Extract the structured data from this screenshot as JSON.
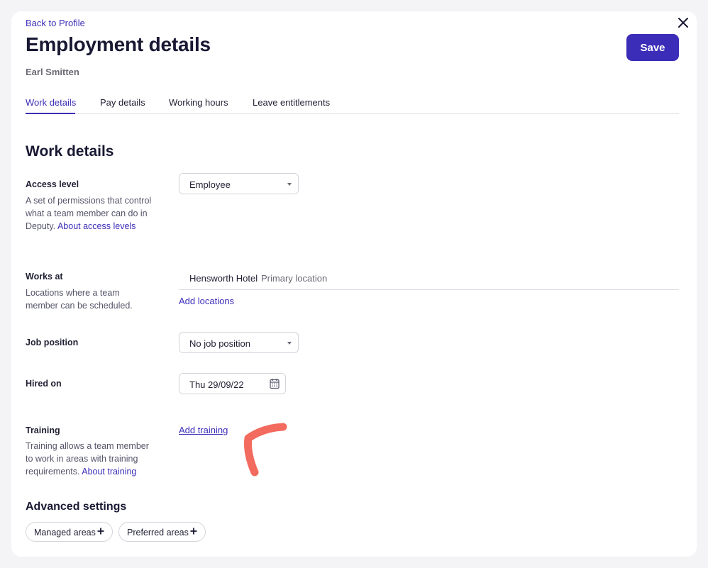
{
  "header": {
    "back_link": "Back to Profile",
    "title": "Employment details",
    "employee_name": "Earl Smitten",
    "save_label": "Save",
    "close_icon": "close-icon"
  },
  "tabs": [
    {
      "label": "Work details",
      "active": true
    },
    {
      "label": "Pay details",
      "active": false
    },
    {
      "label": "Working hours",
      "active": false
    },
    {
      "label": "Leave entitlements",
      "active": false
    }
  ],
  "section_title": "Work details",
  "fields": {
    "access_level": {
      "label": "Access level",
      "help": "A set of permissions that control what a team member can do in Deputy.",
      "help_link": "About access levels",
      "value": "Employee"
    },
    "works_at": {
      "label": "Works at",
      "help": "Locations where a team member can be scheduled.",
      "location_name": "Hensworth Hotel",
      "location_tag": "Primary location",
      "add_link": "Add locations"
    },
    "job_position": {
      "label": "Job position",
      "value": "No job position"
    },
    "hired_on": {
      "label": "Hired on",
      "value": "Thu 29/09/22",
      "icon": "calendar-icon"
    },
    "training": {
      "label": "Training",
      "help": "Training allows a team member to work in areas with training requirements.",
      "help_link": "About training",
      "add_link": "Add training"
    }
  },
  "advanced": {
    "title": "Advanced settings",
    "chips": [
      "Managed areas",
      "Preferred areas"
    ],
    "chip_icon": "plus-icon"
  },
  "colors": {
    "accent": "#3b2db8",
    "annotation": "#f26b5e",
    "background": "#f4f4f6"
  }
}
